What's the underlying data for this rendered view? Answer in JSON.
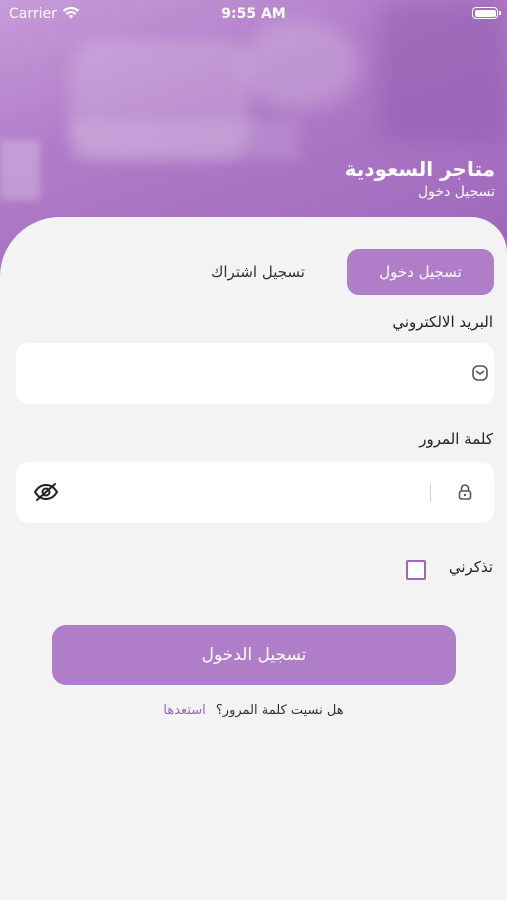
{
  "status_bar": {
    "carrier": "Carrier",
    "time": "9:55 AM"
  },
  "header": {
    "title": "متاجر السعودية",
    "subtitle": "تسجيل دخول"
  },
  "tabs": [
    {
      "label": "تسجيل دخول",
      "active": true
    },
    {
      "label": "تسجيل اشتراك",
      "active": false
    }
  ],
  "email": {
    "label": "البريد الالكتروني",
    "value": "",
    "placeholder": ""
  },
  "password": {
    "label": "كلمة المرور",
    "value": "",
    "placeholder": ""
  },
  "remember": {
    "label": "تذكرني",
    "checked": false
  },
  "login_button": {
    "label": "تسجيل الدخول"
  },
  "forgot": {
    "text": "هل نسيت كلمة المرور؟",
    "link": "استعدها"
  },
  "colors": {
    "accent": "#b07dc9",
    "checkbox_border": "#9a68b4",
    "background": "#f3f3f4"
  },
  "icons": [
    "wifi-icon",
    "battery-icon",
    "mail-icon",
    "lock-icon",
    "eye-off-icon"
  ]
}
